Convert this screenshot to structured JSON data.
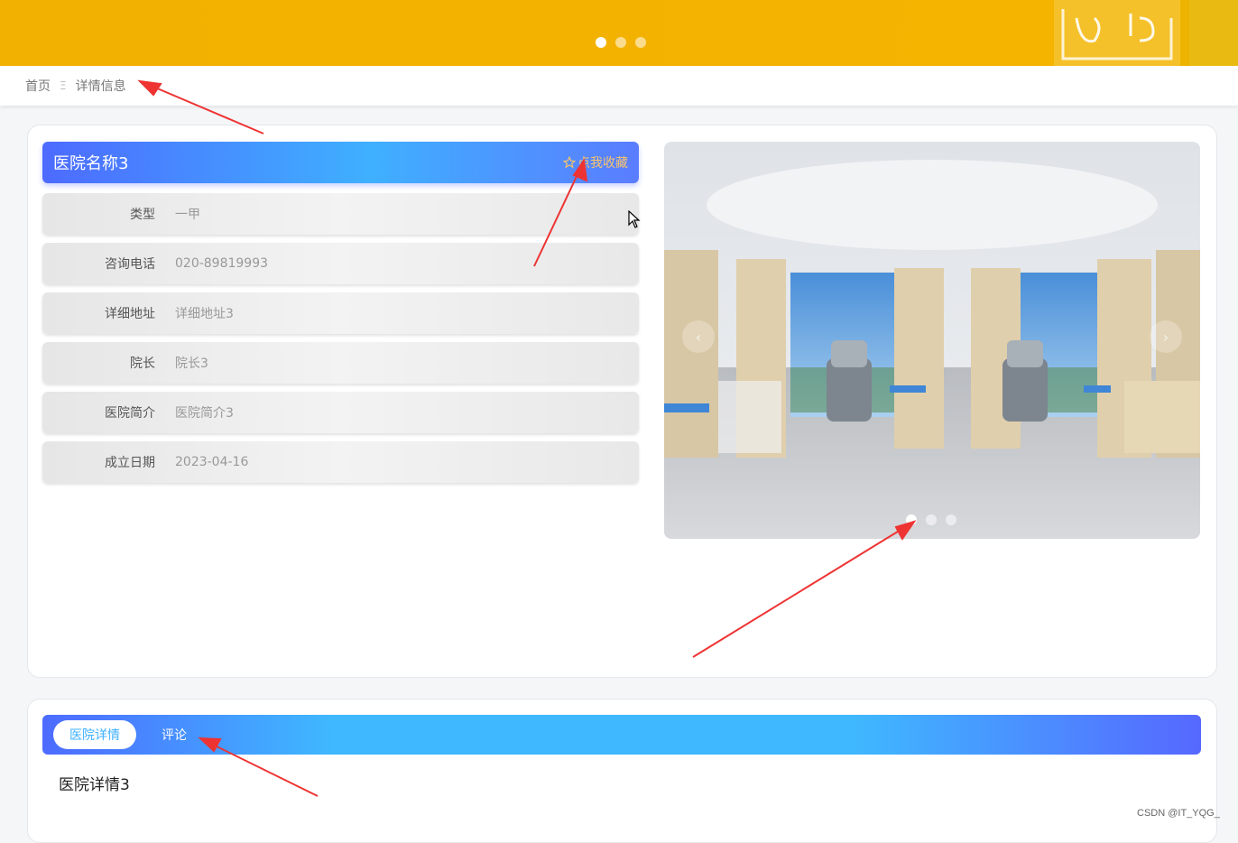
{
  "banner": {
    "dots": 3,
    "active_dot": 0
  },
  "breadcrumb": {
    "home": "首页",
    "separator": "Ξ",
    "current": "详情信息"
  },
  "hospital": {
    "name": "医院名称3",
    "favorite_label": "点我收藏",
    "favorite_icon": "star-outline-icon",
    "fields": [
      {
        "label": "类型",
        "value": "一甲"
      },
      {
        "label": "咨询电话",
        "value": "020-89819993"
      },
      {
        "label": "详细地址",
        "value": "详细地址3"
      },
      {
        "label": "院长",
        "value": "院长3"
      },
      {
        "label": "医院简介",
        "value": "医院简介3"
      },
      {
        "label": "成立日期",
        "value": "2023-04-16"
      }
    ]
  },
  "carousel": {
    "dots": 3,
    "active_dot": 0,
    "prev_icon": "chevron-left-icon",
    "next_icon": "chevron-right-icon",
    "prev_glyph": "‹",
    "next_glyph": "›"
  },
  "tabs": [
    {
      "label": "医院详情",
      "active": true
    },
    {
      "label": "评论",
      "active": false
    }
  ],
  "detail": {
    "text": "医院详情3"
  },
  "watermark": "CSDN @IT_YQG_",
  "colors": {
    "banner": "#f5b400",
    "accent_blue": "#4d6bff",
    "accent_cyan": "#3fb8ff",
    "favorite": "#f7c46c",
    "annotation_red": "#ee3333"
  }
}
